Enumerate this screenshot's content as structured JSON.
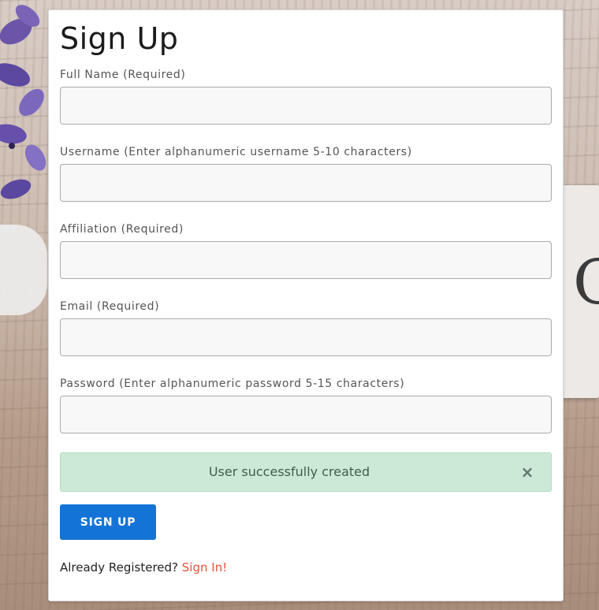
{
  "form": {
    "title": "Sign Up",
    "fields": [
      {
        "label": "Full Name (Required)",
        "value": "",
        "placeholder": ""
      },
      {
        "label": "Username (Enter alphanumeric username 5-10 characters)",
        "value": "",
        "placeholder": ""
      },
      {
        "label": "Affiliation (Required)",
        "value": "",
        "placeholder": ""
      },
      {
        "label": "Email (Required)",
        "value": "",
        "placeholder": ""
      },
      {
        "label": "Password (Enter alphanumeric password 5-15 characters)",
        "value": "",
        "placeholder": ""
      }
    ],
    "alert": {
      "message": "User successfully created",
      "close_glyph": "×",
      "color": "#cce9d7"
    },
    "submit_label": "SIGN UP",
    "footer": {
      "prompt": "Already Registered?",
      "link": "Sign In!"
    }
  },
  "colors": {
    "primary": "#1473d6",
    "link": "#e5533b",
    "success_bg": "#cce9d7"
  },
  "background": {
    "card_letter": "C"
  }
}
